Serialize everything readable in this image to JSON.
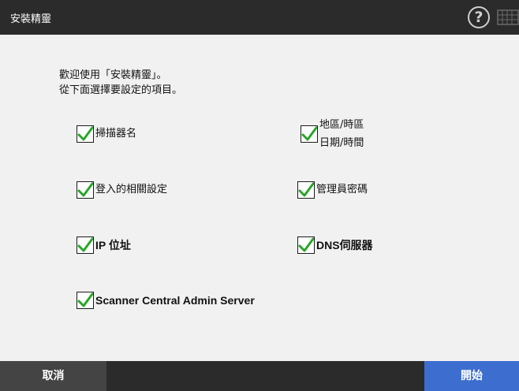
{
  "window": {
    "title": "安裝精靈"
  },
  "header": {
    "help_icon": "question-circle-icon",
    "keyboard_icon": "keyboard-icon"
  },
  "intro": {
    "line1": "歡迎使用「安裝精靈」。",
    "line2": "從下面選擇要設定的項目。"
  },
  "items": [
    {
      "label": "掃描器名",
      "checked": true
    },
    {
      "label_line1": "地區/時區",
      "label_line2": "日期/時間",
      "checked": true
    },
    {
      "label": "登入的相關設定",
      "checked": true
    },
    {
      "label": "管理員密碼",
      "checked": true
    },
    {
      "label": "IP 位址",
      "checked": true
    },
    {
      "label": "DNS伺服器",
      "checked": true
    },
    {
      "label": "Scanner Central Admin Server",
      "checked": true
    }
  ],
  "footer": {
    "cancel_label": "取消",
    "start_label": "開始"
  },
  "colors": {
    "titlebar": "#2b2b2b",
    "check": "#2aa52a",
    "start_button": "#3d6ecf",
    "cancel_button": "#444444"
  }
}
